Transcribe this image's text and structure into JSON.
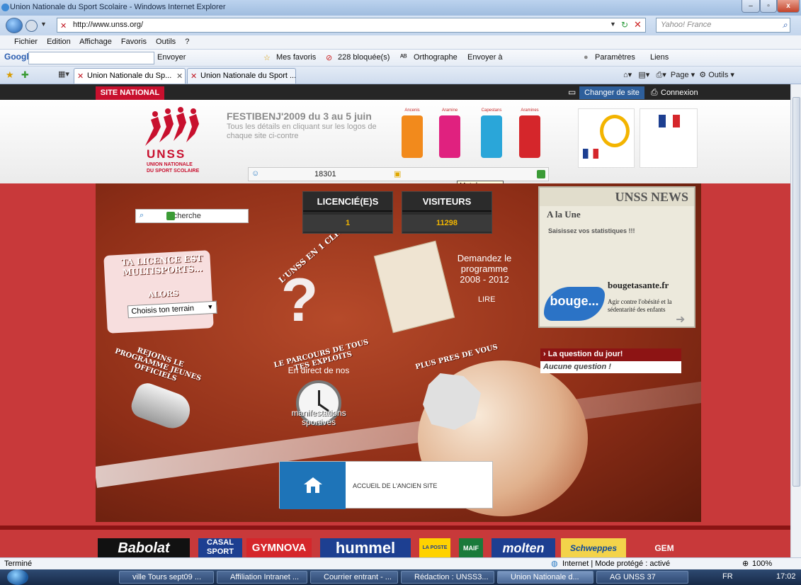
{
  "window": {
    "title": "Union Nationale du Sport Scolaire - Windows Internet Explorer",
    "url": "http://www.unss.org/",
    "search_engine": "Yahoo! France"
  },
  "menu": [
    "Fichier",
    "Edition",
    "Affichage",
    "Favoris",
    "Outils",
    "?"
  ],
  "toolbar": {
    "google": "Google",
    "envoyer": "Envoyer",
    "favoris": "Mes favoris",
    "bloquees": "228 bloquée(s)",
    "orthographe": "Orthographe",
    "envoyer_a": "Envoyer à",
    "parametres": "Paramètres",
    "liens": "Liens"
  },
  "tabs": [
    {
      "label": "Union Nationale du Sp...",
      "active": true
    },
    {
      "label": "Union Nationale du Sport ...",
      "active": false
    }
  ],
  "commands": {
    "page": "Page",
    "outils": "Outils"
  },
  "site": {
    "site_national": "SITE NATIONAL",
    "changer": "Changer de site",
    "connexion": "Connexion",
    "logo_name": "UNSS",
    "logo_sub1": "UNION NATIONALE",
    "logo_sub2": "DU SPORT SCOLAIRE",
    "festi_title": "FESTIBENJ'2009 du 3 au 5 juin",
    "festi_sub": "Tous les détails en cliquant sur les logos de chaque site ci-contre",
    "trophies": [
      {
        "cat": "Ancenis",
        "color": "#f28a1c"
      },
      {
        "cat": "Aramine",
        "color": "#e0217f"
      },
      {
        "cat": "Capestans",
        "color": "#2aa6d9"
      },
      {
        "cat": "Aramines",
        "color": "#d5262b"
      }
    ],
    "login_id": "18301",
    "tooltip": "Mot de passe",
    "search_placeholder": "recherche",
    "licencies_label": "LICENCIÉ(E)S",
    "licencies_value": "1",
    "visiteurs_label": "VISITEURS",
    "visiteurs_value": "11298",
    "news_title": "UNSS NEWS",
    "news_une": "A la Une",
    "news_item": "Saisissez vos statistiques !!!",
    "bouge_logo": "bouge...",
    "bouge_site": "bougetasante.fr",
    "bouge_desc": "Agir contre l'obésité et la sédentarité des enfants",
    "licence_title": "TA LICENCE EST MULTISPORTS...",
    "alors": "ALORS",
    "choisis": "Choisis ton terrain",
    "clic": "L'UNSS EN 1 CLIC",
    "programme": "Demandez le programme 2008 - 2012",
    "lire": "LIRE",
    "jeunes": "REJOINS LE PROGRAMME JEUNES OFFICIELS",
    "parcours": "LE PARCOURS DE TOUS TES EXPLOITS",
    "direct": "En direct de nos",
    "manif": "manifestations sportives",
    "pres": "PLUS PRES DE VOUS",
    "question_title": "› La question du jour!",
    "question_value": "Aucune question !",
    "ancien": "ACCUEIL DE L'ANCIEN SITE"
  },
  "sponsors": [
    "Babolat",
    "CASAL SPORT",
    "GYMNOVA",
    "hummel",
    "LA POSTE",
    "MAIF",
    "molten",
    "Schweppes",
    "GEM"
  ],
  "status": {
    "left": "Terminé",
    "zone": "Internet | Mode protégé : activé",
    "zoom": "100%"
  },
  "taskbar": {
    "items": [
      {
        "label": "ville Tours sept09 ...",
        "active": false
      },
      {
        "label": "Affiliation Intranet ...",
        "active": false
      },
      {
        "label": "Courrier entrant - ...",
        "active": false
      },
      {
        "label": "Rédaction : UNSS3...",
        "active": false
      },
      {
        "label": "Union Nationale d...",
        "active": true
      },
      {
        "label": "AG UNSS 37",
        "active": false
      }
    ],
    "lang": "FR",
    "clock": "17:02"
  }
}
